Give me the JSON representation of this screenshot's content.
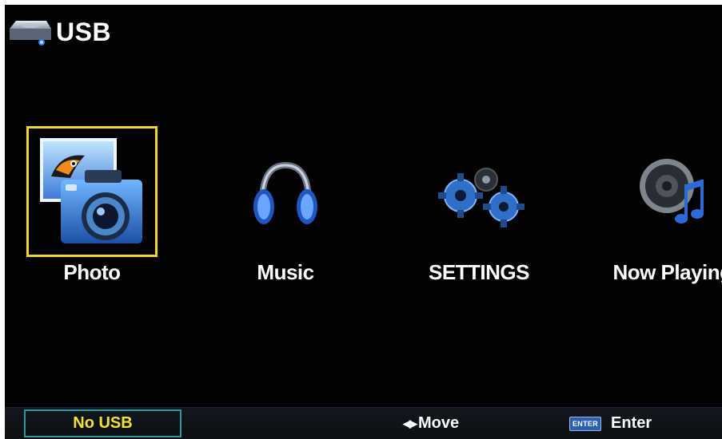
{
  "header": {
    "title": "USB",
    "icon": "usb-drive-icon"
  },
  "menu": {
    "items": [
      {
        "label": "Photo",
        "icon": "photo-camera-icon",
        "selected": true
      },
      {
        "label": "Music",
        "icon": "headphones-icon",
        "selected": false
      },
      {
        "label": "SETTINGS",
        "icon": "gears-icon",
        "selected": false
      },
      {
        "label": "Now Playing",
        "icon": "speaker-note-icon",
        "selected": false
      }
    ]
  },
  "status": {
    "no_usb": "No USB",
    "move_label": "Move",
    "move_arrows": "◀▶",
    "enter_key": "ENTER",
    "enter_label": "Enter"
  },
  "colors": {
    "background": "#020203",
    "selection": "#f2d535",
    "status_text": "#f1e23a",
    "status_border": "#2a9a9e",
    "icon_blue": "#2f86d8"
  }
}
